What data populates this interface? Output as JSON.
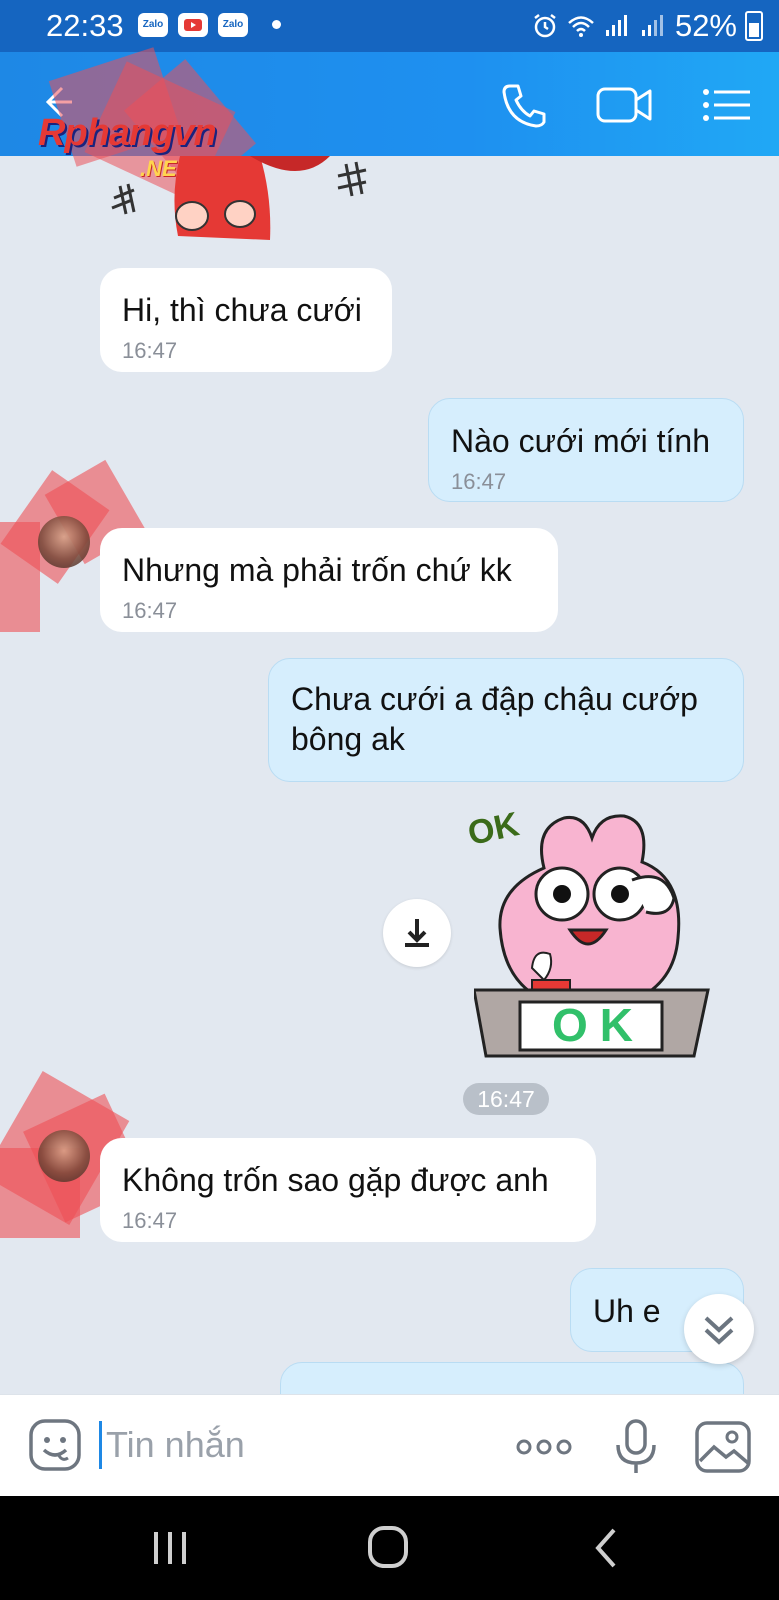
{
  "status_bar": {
    "time": "22:33",
    "apps": [
      "Zalo",
      "",
      "Zalo"
    ],
    "battery": "52%"
  },
  "header": {
    "watermark_line1": "Rphangvn",
    "watermark_line2": ".NET",
    "icons": [
      "back-arrow-icon",
      "phone-icon",
      "video-call-icon",
      "menu-list-icon"
    ]
  },
  "messages": [
    {
      "side": "in",
      "text": "Hi, thì chưa cưới",
      "time": "16:47"
    },
    {
      "side": "out",
      "text": "Nào cưới mới tính",
      "time": "16:47"
    },
    {
      "side": "in",
      "text": "Nhưng mà phải trốn chứ kk",
      "time": "16:47"
    },
    {
      "side": "out",
      "text": "Chưa cưới a đập chậu cướp bông ak",
      "time": ""
    },
    {
      "side": "in",
      "text": "Không trốn sao gặp được anh",
      "time": "16:47"
    },
    {
      "side": "out",
      "text": "Uh e",
      "time": ""
    }
  ],
  "sticker": {
    "top_text": "OK",
    "sign_text": "OK",
    "time": "16:47"
  },
  "input": {
    "placeholder": "Tin nhắn"
  },
  "colors": {
    "header_start": "#1e88e5",
    "header_end": "#20a8f5",
    "status_bar": "#1565c0",
    "chat_background": "#e2e8f0",
    "outgoing_bubble": "#d6eefd",
    "incoming_bubble": "#ffffff"
  }
}
